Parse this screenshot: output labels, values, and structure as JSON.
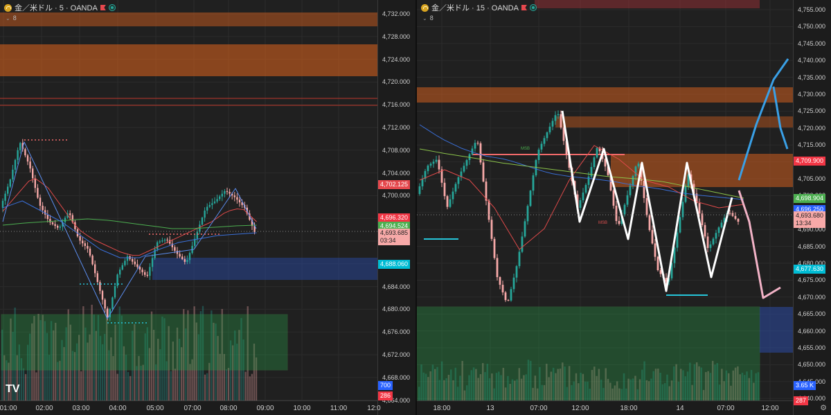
{
  "left_chart": {
    "symbol_title": "金／米ドル · 5 · OANDA",
    "indicator_count": "8",
    "y_labels": [
      "4,732.000",
      "4,728.000",
      "4,724.000",
      "4,720.000",
      "4,716.000",
      "4,712.000",
      "4,708.000",
      "4,704.000",
      "4,700.000",
      "4,696.000",
      "4,692.000",
      "4,688.000",
      "4,684.000",
      "4,680.000",
      "4,676.000",
      "4,672.000",
      "4,668.000",
      "4,664.000"
    ],
    "tags": [
      {
        "text": "4,702.125",
        "color": "#e5484d"
      },
      {
        "text": "4,696.320",
        "color": "#f23645"
      },
      {
        "text": "4,694.524",
        "color": "#4caf50"
      },
      {
        "text": "4,693.685",
        "sub": "03:34",
        "color": "#f7a9a8"
      },
      {
        "text": "4,688.060",
        "color": "#00bcd4"
      },
      {
        "text": "700",
        "color": "#2962ff"
      },
      {
        "text": "286",
        "color": "#f23645"
      }
    ],
    "x_labels": [
      "01:00",
      "02:00",
      "03:00",
      "04:00",
      "05:00",
      "07:00",
      "08:00",
      "09:00",
      "10:00",
      "11:00",
      "12:0"
    ]
  },
  "right_chart": {
    "symbol_title": "金／米ドル · 15 · OANDA",
    "indicator_count": "8",
    "y_labels": [
      "4,755.000",
      "4,750.000",
      "4,745.000",
      "4,740.000",
      "4,735.000",
      "4,730.000",
      "4,725.000",
      "4,720.000",
      "4,715.000",
      "4,710.000",
      "4,705.000",
      "4,700.000",
      "4,695.000",
      "4,690.000",
      "4,685.000",
      "4,680.000",
      "4,675.000",
      "4,670.000",
      "4,665.000",
      "4,660.000",
      "4,655.000",
      "4,650.000",
      "4,645.000",
      "4,640.000"
    ],
    "tags": [
      {
        "text": "4,709.900",
        "color": "#f23645"
      },
      {
        "text": "4,698.904",
        "color": "#4caf50"
      },
      {
        "text": "4,696.250",
        "color": "#2962ff"
      },
      {
        "text": "4,693.680",
        "sub": "13:34",
        "color": "#f7a9a8"
      },
      {
        "text": "4,677.630",
        "color": "#00bcd4"
      },
      {
        "text": "3.65 K",
        "color": "#2962ff"
      },
      {
        "text": "287",
        "color": "#f23645"
      }
    ],
    "x_labels": [
      "18:00",
      "13",
      "07:00",
      "12:00",
      "18:00",
      "14",
      "07:00",
      "12:00"
    ],
    "annotations": [
      "MSB",
      "MSB"
    ]
  },
  "colors": {
    "bull": "#26a69a",
    "bear": "#f7a9a8",
    "supply": "#e0641e",
    "demand": "#2a9d4a",
    "blue_zone": "#2b4db0"
  },
  "logo": "TV"
}
